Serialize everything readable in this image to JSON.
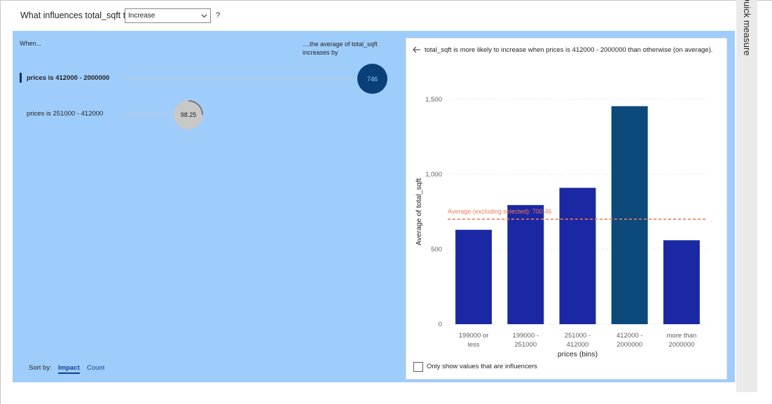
{
  "question": {
    "prefix": "What influences total_sqft to",
    "dropdown_value": "Increase",
    "suffix": "?"
  },
  "side_pane": {
    "title": "Quick measure"
  },
  "influencers": {
    "col_when": "When...",
    "col_avg": "....the average of total_sqft increases by",
    "rows": [
      {
        "label": "prices is 412000 - 2000000",
        "value": "746",
        "selected": true
      },
      {
        "label": "prices is 251000 - 412000",
        "value": "98.25",
        "selected": false
      }
    ],
    "sort_by_label": "Sort by:",
    "sort_options": [
      "Impact",
      "Count"
    ],
    "active_sort": "Impact"
  },
  "detail": {
    "title": "total_sqft is more likely to increase when prices is 412000 - 2000000 than otherwise (on average).",
    "checkbox_label": "Only show values that are influencers",
    "checkbox_checked": false
  },
  "chart_data": {
    "type": "bar",
    "categories": [
      "199000 or less",
      "199000 - 251000",
      "251000 - 412000",
      "412000 - 2000000",
      "more than 2000000"
    ],
    "category_lines": [
      [
        "199000 or",
        "less"
      ],
      [
        "199000 -",
        "251000"
      ],
      [
        "251000 -",
        "412000"
      ],
      [
        "412000 -",
        "2000000"
      ],
      [
        "more than",
        "2000000"
      ]
    ],
    "values": [
      630,
      795,
      910,
      1455,
      560
    ],
    "highlight_index": 3,
    "xlabel": "prices (bins)",
    "ylabel": "Average of total_sqft",
    "ylim": [
      0,
      1500
    ],
    "yticks": [
      0,
      500,
      1000,
      1500
    ],
    "ytick_labels": [
      "0",
      "500",
      "1,000",
      "1,500"
    ],
    "reference_line": {
      "label": "Average (excluding selected): 700.46",
      "value": 700.46
    },
    "colors": {
      "bar": "#1a29a3",
      "highlight": "#0d4a7c",
      "reference": "#f07a5c",
      "grid": "#c8c6c4"
    },
    "grid": true
  }
}
